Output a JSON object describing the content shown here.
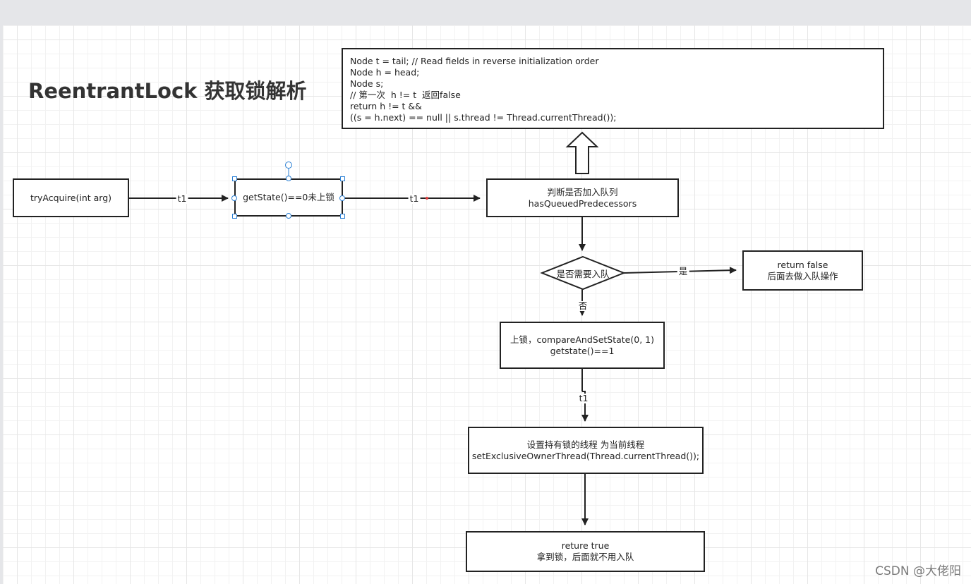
{
  "title": "ReentrantLock 获取锁解析",
  "code_box": {
    "lines": [
      "Node t = tail; // Read fields in reverse initialization order",
      "Node h = head;",
      "Node s;",
      "// 第一次  h != t  返回false",
      "return h != t &&",
      "((s = h.next) == null || s.thread != Thread.currentThread());"
    ]
  },
  "nodes": {
    "try_acquire": {
      "line1": "tryAcquire(int arg)"
    },
    "get_state": {
      "line1": "getState()==0未上锁"
    },
    "has_queued": {
      "line1": "判断是否加入队列",
      "line2": "hasQueuedPredecessors"
    },
    "decision": {
      "label": "是否需要入队"
    },
    "return_false": {
      "line1": "return false",
      "line2": "后面去做入队操作"
    },
    "lock": {
      "line1": "上锁，compareAndSetState(0, 1)",
      "line2": "getstate()==1"
    },
    "set_owner": {
      "line1": "设置持有锁的线程 为当前线程",
      "line2": "setExclusiveOwnerThread(Thread.currentThread());"
    },
    "return_true": {
      "line1": "reture true",
      "line2": "拿到锁，后面就不用入队"
    }
  },
  "edge_labels": {
    "try_to_state": "t1",
    "state_to_queue": "t1",
    "yes": "是",
    "no": "否",
    "lock_to_owner": "t1"
  },
  "colors": {
    "stroke": "#222222",
    "selection": "#2a7fd4",
    "waypoint": "#e03b3b",
    "grid": "#e6e6e6"
  },
  "watermark": "CSDN @大佬阳"
}
